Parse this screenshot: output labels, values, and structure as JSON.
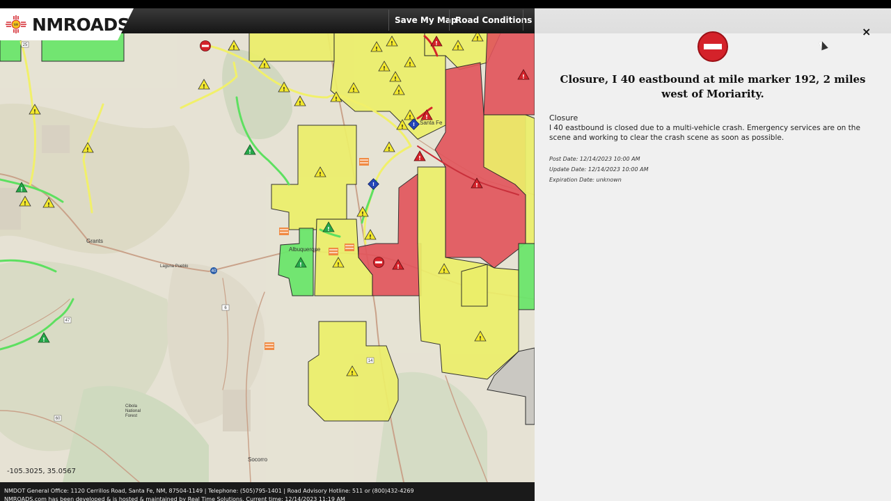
{
  "header": {
    "logo_text": "NMROADS",
    "nav": [
      "Save My Map",
      "Road Conditions"
    ]
  },
  "map": {
    "coordinate_readout": "-105.3025, 35.0567",
    "place_labels": [
      "Grants",
      "Albuquerque",
      "Santa Fe",
      "Socorro",
      "Laguna Pueblo",
      "Cibola National Forest"
    ],
    "route_shields": [
      "40",
      "25",
      "285",
      "60",
      "47",
      "6",
      "14"
    ],
    "colors": {
      "yellow_zone": "#ecef6a",
      "red_zone": "#e2545b",
      "green_zone": "#6ce66c",
      "yellow_road": "#f1f06a",
      "green_road": "#5de060"
    }
  },
  "footer": {
    "line1": "NMDOT General Office: 1120 Cerrillos Road, Santa Fe, NM, 87504-1149 | Telephone: (505)795-1401 | Road Advisory Hotline: 511 or (800)432-4269",
    "line2": "NMROADS.com has been developed & is hosted & maintained by Real Time Solutions. Current time: 12/14/2023 11:19 AM"
  },
  "panel": {
    "close_label": "×",
    "icon": "do-not-enter-icon",
    "title": "Closure, I 40 eastbound at mile marker 192, 2 miles west of Moriarity.",
    "category": "Closure",
    "description": "I 40 eastbound is closed due to a multi-vehicle crash. Emergency services are on the scene and working to clear the crash scene as soon as possible.",
    "post_date": "Post Date: 12/14/2023 10:00 AM",
    "update_date": "Update Date: 12/14/2023 10:00 AM",
    "expiration_date": "Expiration Date: unknown"
  }
}
